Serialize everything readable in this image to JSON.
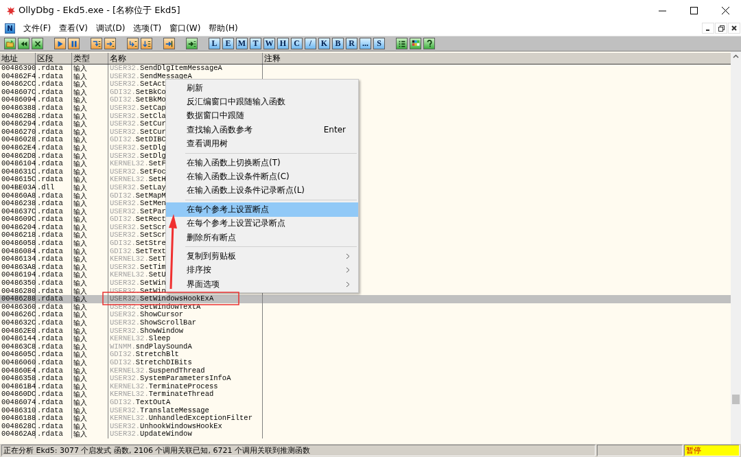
{
  "window": {
    "title": "OllyDbg - Ekd5.exe - [名称位于 Ekd5]"
  },
  "menu_bar": {
    "badge": "N",
    "items": [
      "文件(F)",
      "查看(V)",
      "调试(D)",
      "选项(T)",
      "窗口(W)",
      "帮助(H)"
    ]
  },
  "toolbar": {
    "letter_buttons": [
      "L",
      "E",
      "M",
      "T",
      "W",
      "H",
      "C",
      "/",
      "K",
      "B",
      "R",
      "...",
      "S"
    ]
  },
  "table": {
    "columns": [
      "地址",
      "区段",
      "类型",
      "名称",
      "注释"
    ],
    "rows": [
      {
        "address": "00486390",
        "section": ".rdata",
        "type": "输入",
        "module": "USER32.",
        "name": "SendDlgItemMessageA",
        "selected": false
      },
      {
        "address": "004862F4",
        "section": ".rdata",
        "type": "输入",
        "module": "USER32.",
        "name": "SendMessageA",
        "selected": false
      },
      {
        "address": "004862CC",
        "section": ".rdata",
        "type": "输入",
        "module": "USER32.",
        "name": "SetAct",
        "selected": false
      },
      {
        "address": "0048607C",
        "section": ".rdata",
        "type": "输入",
        "module": "GDI32.",
        "name": "SetBkCo",
        "selected": false
      },
      {
        "address": "00486094",
        "section": ".rdata",
        "type": "输入",
        "module": "GDI32.",
        "name": "SetBkMo",
        "selected": false
      },
      {
        "address": "00486388",
        "section": ".rdata",
        "type": "输入",
        "module": "USER32.",
        "name": "SetCap",
        "selected": false
      },
      {
        "address": "004862B8",
        "section": ".rdata",
        "type": "输入",
        "module": "USER32.",
        "name": "SetCla",
        "selected": false
      },
      {
        "address": "00486294",
        "section": ".rdata",
        "type": "输入",
        "module": "USER32.",
        "name": "SetCur",
        "selected": false
      },
      {
        "address": "00486270",
        "section": ".rdata",
        "type": "输入",
        "module": "USER32.",
        "name": "SetCur",
        "selected": false
      },
      {
        "address": "00486028",
        "section": ".rdata",
        "type": "输入",
        "module": "GDI32.",
        "name": "SetDIBC",
        "selected": false
      },
      {
        "address": "004862E4",
        "section": ".rdata",
        "type": "输入",
        "module": "USER32.",
        "name": "SetDlg",
        "selected": false
      },
      {
        "address": "004862D8",
        "section": ".rdata",
        "type": "输入",
        "module": "USER32.",
        "name": "SetDlg",
        "selected": false
      },
      {
        "address": "00486104",
        "section": ".rdata",
        "type": "输入",
        "module": "KERNEL32.",
        "name": "SetF",
        "selected": false
      },
      {
        "address": "0048631C",
        "section": ".rdata",
        "type": "输入",
        "module": "USER32.",
        "name": "SetFoc",
        "selected": false
      },
      {
        "address": "0048615C",
        "section": ".rdata",
        "type": "输入",
        "module": "KERNEL32.",
        "name": "SetH",
        "selected": false
      },
      {
        "address": "004BE03A",
        "section": ".dll",
        "type": "输入",
        "module": "USER32.",
        "name": "SetLay",
        "selected": false
      },
      {
        "address": "004860A8",
        "section": ".rdata",
        "type": "输入",
        "module": "GDI32.",
        "name": "SetMapM",
        "selected": false
      },
      {
        "address": "00486238",
        "section": ".rdata",
        "type": "输入",
        "module": "USER32.",
        "name": "SetMen",
        "selected": false
      },
      {
        "address": "0048637C",
        "section": ".rdata",
        "type": "输入",
        "module": "USER32.",
        "name": "SetPar",
        "selected": false
      },
      {
        "address": "0048609C",
        "section": ".rdata",
        "type": "输入",
        "module": "GDI32.",
        "name": "SetRect",
        "selected": false
      },
      {
        "address": "00486204",
        "section": ".rdata",
        "type": "输入",
        "module": "USER32.",
        "name": "SetScr",
        "selected": false
      },
      {
        "address": "00486218",
        "section": ".rdata",
        "type": "输入",
        "module": "USER32.",
        "name": "SetScr",
        "selected": false
      },
      {
        "address": "00486058",
        "section": ".rdata",
        "type": "输入",
        "module": "GDI32.",
        "name": "SetStre",
        "selected": false
      },
      {
        "address": "00486084",
        "section": ".rdata",
        "type": "输入",
        "module": "GDI32.",
        "name": "SetText",
        "selected": false
      },
      {
        "address": "00486134",
        "section": ".rdata",
        "type": "输入",
        "module": "KERNEL32.",
        "name": "SetT",
        "selected": false
      },
      {
        "address": "004863A8",
        "section": ".rdata",
        "type": "输入",
        "module": "USER32.",
        "name": "SetTim",
        "selected": false
      },
      {
        "address": "00486194",
        "section": ".rdata",
        "type": "输入",
        "module": "KERNEL32.",
        "name": "SetU",
        "selected": false
      },
      {
        "address": "00486350",
        "section": ".rdata",
        "type": "输入",
        "module": "USER32.",
        "name": "SetWin",
        "selected": false
      },
      {
        "address": "00486280",
        "section": ".rdata",
        "type": "输入",
        "module": "USER32.",
        "name": "SetWin",
        "selected": false
      },
      {
        "address": "00486288",
        "section": ".rdata",
        "type": "输入",
        "module": "USER32.",
        "name": "SetWindowsHookExA",
        "selected": true
      },
      {
        "address": "00486360",
        "section": ".rdata",
        "type": "输入",
        "module": "USER32.",
        "name": "SetWindowTextA",
        "selected": false
      },
      {
        "address": "0048626C",
        "section": ".rdata",
        "type": "输入",
        "module": "USER32.",
        "name": "ShowCursor",
        "selected": false
      },
      {
        "address": "0048632C",
        "section": ".rdata",
        "type": "输入",
        "module": "USER32.",
        "name": "ShowScrollBar",
        "selected": false
      },
      {
        "address": "004862E0",
        "section": ".rdata",
        "type": "输入",
        "module": "USER32.",
        "name": "ShowWindow",
        "selected": false
      },
      {
        "address": "00486144",
        "section": ".rdata",
        "type": "输入",
        "module": "KERNEL32.",
        "name": "Sleep",
        "selected": false
      },
      {
        "address": "004863C8",
        "section": ".rdata",
        "type": "输入",
        "module": "WINMM.",
        "name": "sndPlaySoundA",
        "selected": false
      },
      {
        "address": "0048605C",
        "section": ".rdata",
        "type": "输入",
        "module": "GDI32.",
        "name": "StretchBlt",
        "selected": false
      },
      {
        "address": "00486060",
        "section": ".rdata",
        "type": "输入",
        "module": "GDI32.",
        "name": "StretchDIBits",
        "selected": false
      },
      {
        "address": "004860E4",
        "section": ".rdata",
        "type": "输入",
        "module": "KERNEL32.",
        "name": "SuspendThread",
        "selected": false
      },
      {
        "address": "00486358",
        "section": ".rdata",
        "type": "输入",
        "module": "USER32.",
        "name": "SystemParametersInfoA",
        "selected": false
      },
      {
        "address": "004861B4",
        "section": ".rdata",
        "type": "输入",
        "module": "KERNEL32.",
        "name": "TerminateProcess",
        "selected": false
      },
      {
        "address": "004860DC",
        "section": ".rdata",
        "type": "输入",
        "module": "KERNEL32.",
        "name": "TerminateThread",
        "selected": false
      },
      {
        "address": "00486074",
        "section": ".rdata",
        "type": "输入",
        "module": "GDI32.",
        "name": "TextOutA",
        "selected": false
      },
      {
        "address": "00486310",
        "section": ".rdata",
        "type": "输入",
        "module": "USER32.",
        "name": "TranslateMessage",
        "selected": false
      },
      {
        "address": "00486188",
        "section": ".rdata",
        "type": "输入",
        "module": "KERNEL32.",
        "name": "UnhandledExceptionFilter",
        "selected": false
      },
      {
        "address": "0048628C",
        "section": ".rdata",
        "type": "输入",
        "module": "USER32.",
        "name": "UnhookWindowsHookEx",
        "selected": false
      },
      {
        "address": "004862A8",
        "section": ".rdata",
        "type": "输入",
        "module": "USER32.",
        "name": "UpdateWindow",
        "selected": false
      }
    ]
  },
  "context_menu": {
    "groups": [
      [
        {
          "label": "刷新",
          "selected": false
        },
        {
          "label": "反汇编窗口中跟随输入函数",
          "selected": false
        },
        {
          "label": "数据窗口中跟随",
          "selected": false
        },
        {
          "label": "查找输入函数参考",
          "shortcut": "Enter",
          "selected": false
        },
        {
          "label": "查看调用树",
          "selected": false
        }
      ],
      [
        {
          "label": "在输入函数上切换断点(T)",
          "selected": false
        },
        {
          "label": "在输入函数上设条件断点(C)",
          "selected": false
        },
        {
          "label": "在输入函数上设条件记录断点(L)",
          "selected": false
        }
      ],
      [
        {
          "label": "在每个参考上设置断点",
          "selected": true
        },
        {
          "label": "在每个参考上设置记录断点",
          "selected": false
        },
        {
          "label": "删除所有断点",
          "selected": false
        }
      ],
      [
        {
          "label": "复制到剪贴板",
          "submenu": true,
          "selected": false
        },
        {
          "label": "排序按",
          "submenu": true,
          "selected": false
        },
        {
          "label": "界面选项",
          "submenu": true,
          "selected": false
        }
      ]
    ]
  },
  "status_bar": {
    "message": "正在分析 Ekd5: 3077 个启发式 函数, 2106 个调用关联已知, 6721 个调用关联到推测函数",
    "state": "暂停"
  }
}
